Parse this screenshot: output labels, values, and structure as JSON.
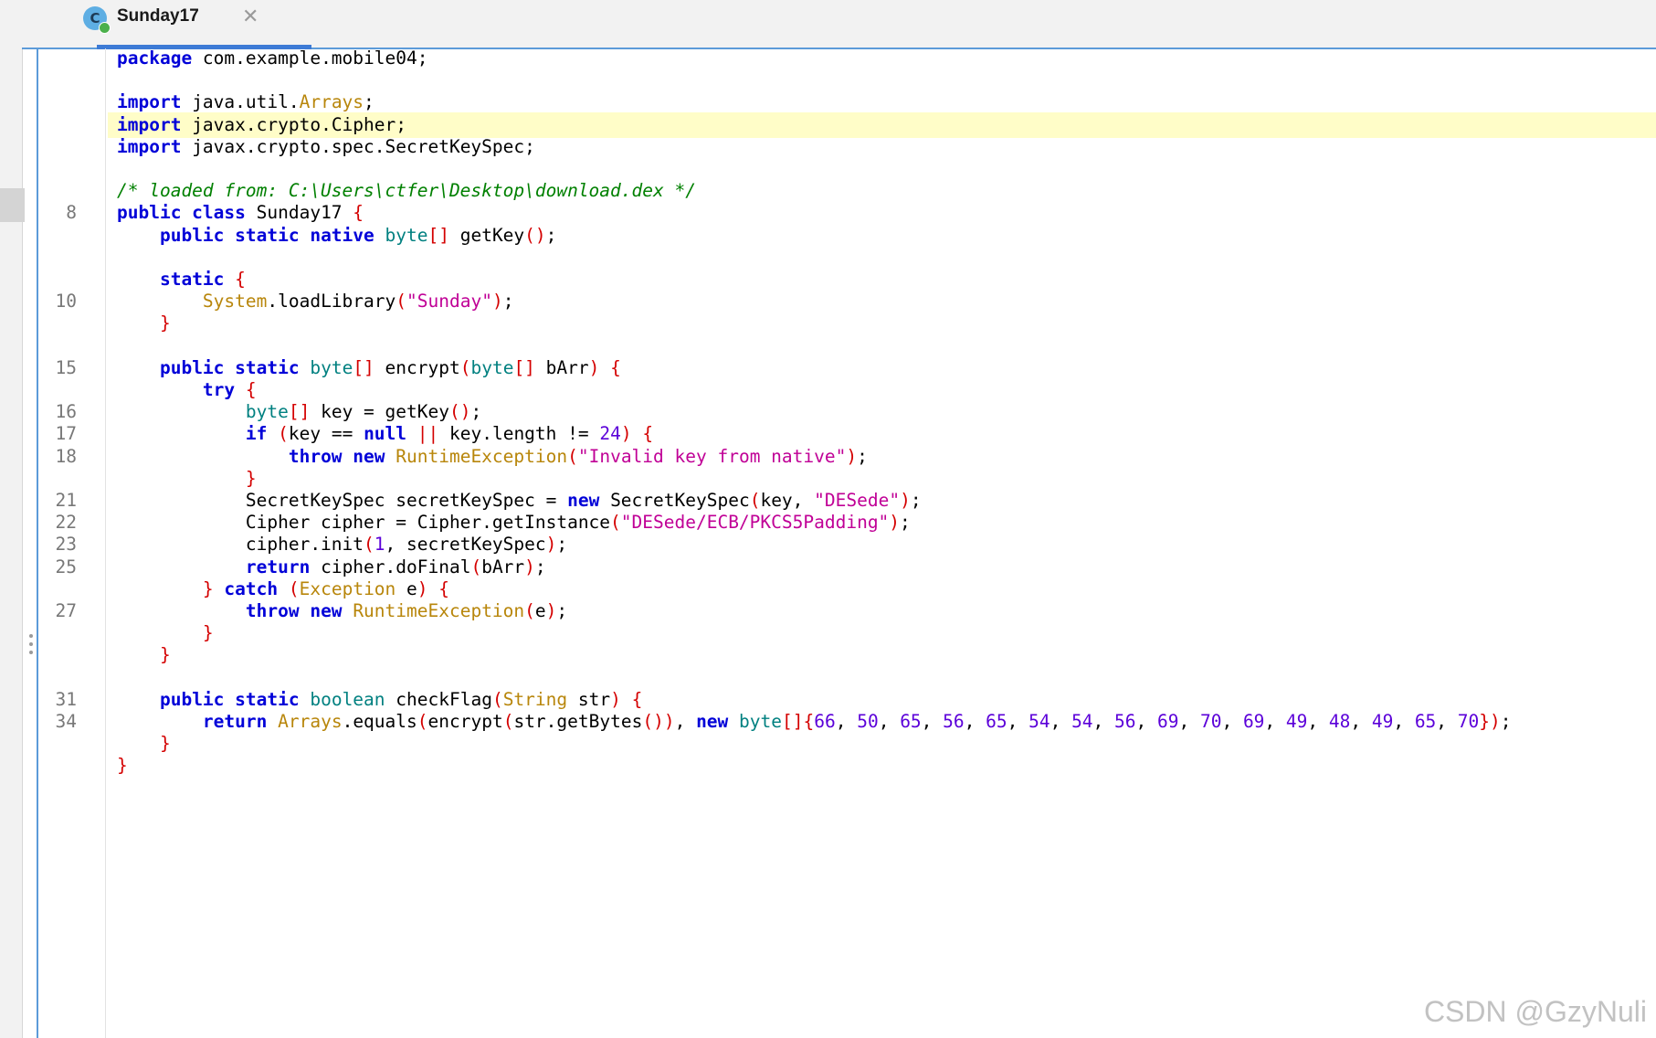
{
  "tab": {
    "title": "Sunday17",
    "icon_letter": "C",
    "close_glyph": "✕"
  },
  "code_lines": [
    {
      "num": "",
      "tokens": [
        [
          "kw",
          "package"
        ],
        [
          "p",
          " com.example.mobile04;"
        ]
      ]
    },
    {
      "num": "",
      "tokens": []
    },
    {
      "num": "",
      "tokens": [
        [
          "kw",
          "import"
        ],
        [
          "p",
          " java.util."
        ],
        [
          "cl",
          "Arrays"
        ],
        [
          "p",
          ";"
        ]
      ]
    },
    {
      "num": "",
      "highlight": true,
      "tokens": [
        [
          "kw",
          "import"
        ],
        [
          "p",
          " javax.crypto.Cipher;"
        ]
      ]
    },
    {
      "num": "",
      "tokens": [
        [
          "kw",
          "import"
        ],
        [
          "p",
          " javax.crypto.spec.SecretKeySpec;"
        ]
      ]
    },
    {
      "num": "",
      "tokens": []
    },
    {
      "num": "",
      "tokens": [
        [
          "cm",
          "/* loaded from: C:\\Users\\ctfer\\Desktop\\download.dex */"
        ]
      ]
    },
    {
      "num": "8",
      "tokens": [
        [
          "kw",
          "public class"
        ],
        [
          "p",
          " Sunday17 "
        ],
        [
          "br",
          "{"
        ]
      ]
    },
    {
      "num": "",
      "tokens": [
        [
          "p",
          "    "
        ],
        [
          "kw",
          "public static native"
        ],
        [
          "p",
          " "
        ],
        [
          "ty",
          "byte"
        ],
        [
          "br",
          "[]"
        ],
        [
          "p",
          " getKey"
        ],
        [
          "br",
          "()"
        ],
        [
          "p",
          ";"
        ]
      ]
    },
    {
      "num": "",
      "tokens": []
    },
    {
      "num": "",
      "tokens": [
        [
          "p",
          "    "
        ],
        [
          "kw",
          "static"
        ],
        [
          "p",
          " "
        ],
        [
          "br",
          "{"
        ]
      ]
    },
    {
      "num": "10",
      "tokens": [
        [
          "p",
          "        "
        ],
        [
          "cl",
          "System"
        ],
        [
          "p",
          ".loadLibrary"
        ],
        [
          "br",
          "("
        ],
        [
          "st",
          "\"Sunday\""
        ],
        [
          "br",
          ")"
        ],
        [
          "p",
          ";"
        ]
      ]
    },
    {
      "num": "",
      "tokens": [
        [
          "p",
          "    "
        ],
        [
          "br",
          "}"
        ]
      ]
    },
    {
      "num": "",
      "tokens": []
    },
    {
      "num": "15",
      "tokens": [
        [
          "p",
          "    "
        ],
        [
          "kw",
          "public static"
        ],
        [
          "p",
          " "
        ],
        [
          "ty",
          "byte"
        ],
        [
          "br",
          "[]"
        ],
        [
          "p",
          " encrypt"
        ],
        [
          "br",
          "("
        ],
        [
          "ty",
          "byte"
        ],
        [
          "br",
          "[]"
        ],
        [
          "p",
          " bArr"
        ],
        [
          "br",
          ")"
        ],
        [
          "p",
          " "
        ],
        [
          "br",
          "{"
        ]
      ]
    },
    {
      "num": "",
      "tokens": [
        [
          "p",
          "        "
        ],
        [
          "kw",
          "try"
        ],
        [
          "p",
          " "
        ],
        [
          "br",
          "{"
        ]
      ]
    },
    {
      "num": "16",
      "tokens": [
        [
          "p",
          "            "
        ],
        [
          "ty",
          "byte"
        ],
        [
          "br",
          "[]"
        ],
        [
          "p",
          " key = getKey"
        ],
        [
          "br",
          "()"
        ],
        [
          "p",
          ";"
        ]
      ]
    },
    {
      "num": "17",
      "tokens": [
        [
          "p",
          "            "
        ],
        [
          "kw",
          "if"
        ],
        [
          "p",
          " "
        ],
        [
          "br",
          "("
        ],
        [
          "p",
          "key == "
        ],
        [
          "kw",
          "null"
        ],
        [
          "p",
          " "
        ],
        [
          "br",
          "||"
        ],
        [
          "p",
          " key.length != "
        ],
        [
          "nu",
          "24"
        ],
        [
          "br",
          ")"
        ],
        [
          "p",
          " "
        ],
        [
          "br",
          "{"
        ]
      ]
    },
    {
      "num": "18",
      "tokens": [
        [
          "p",
          "                "
        ],
        [
          "kw",
          "throw new"
        ],
        [
          "p",
          " "
        ],
        [
          "cl",
          "RuntimeException"
        ],
        [
          "br",
          "("
        ],
        [
          "st",
          "\"Invalid key from native\""
        ],
        [
          "br",
          ")"
        ],
        [
          "p",
          ";"
        ]
      ]
    },
    {
      "num": "",
      "tokens": [
        [
          "p",
          "            "
        ],
        [
          "br",
          "}"
        ]
      ]
    },
    {
      "num": "21",
      "tokens": [
        [
          "p",
          "            SecretKeySpec secretKeySpec = "
        ],
        [
          "kw",
          "new"
        ],
        [
          "p",
          " SecretKeySpec"
        ],
        [
          "br",
          "("
        ],
        [
          "p",
          "key, "
        ],
        [
          "st",
          "\"DESede\""
        ],
        [
          "br",
          ")"
        ],
        [
          "p",
          ";"
        ]
      ]
    },
    {
      "num": "22",
      "tokens": [
        [
          "p",
          "            Cipher cipher = Cipher.getInstance"
        ],
        [
          "br",
          "("
        ],
        [
          "st",
          "\"DESede/ECB/PKCS5Padding\""
        ],
        [
          "br",
          ")"
        ],
        [
          "p",
          ";"
        ]
      ]
    },
    {
      "num": "23",
      "tokens": [
        [
          "p",
          "            cipher.init"
        ],
        [
          "br",
          "("
        ],
        [
          "nu",
          "1"
        ],
        [
          "p",
          ", secretKeySpec"
        ],
        [
          "br",
          ")"
        ],
        [
          "p",
          ";"
        ]
      ]
    },
    {
      "num": "25",
      "tokens": [
        [
          "p",
          "            "
        ],
        [
          "kw",
          "return"
        ],
        [
          "p",
          " cipher.doFinal"
        ],
        [
          "br",
          "("
        ],
        [
          "p",
          "bArr"
        ],
        [
          "br",
          ")"
        ],
        [
          "p",
          ";"
        ]
      ]
    },
    {
      "num": "",
      "tokens": [
        [
          "p",
          "        "
        ],
        [
          "br",
          "}"
        ],
        [
          "p",
          " "
        ],
        [
          "kw",
          "catch"
        ],
        [
          "p",
          " "
        ],
        [
          "br",
          "("
        ],
        [
          "cl",
          "Exception"
        ],
        [
          "p",
          " e"
        ],
        [
          "br",
          ")"
        ],
        [
          "p",
          " "
        ],
        [
          "br",
          "{"
        ]
      ]
    },
    {
      "num": "27",
      "tokens": [
        [
          "p",
          "            "
        ],
        [
          "kw",
          "throw new"
        ],
        [
          "p",
          " "
        ],
        [
          "cl",
          "RuntimeException"
        ],
        [
          "br",
          "("
        ],
        [
          "p",
          "e"
        ],
        [
          "br",
          ")"
        ],
        [
          "p",
          ";"
        ]
      ]
    },
    {
      "num": "",
      "tokens": [
        [
          "p",
          "        "
        ],
        [
          "br",
          "}"
        ]
      ]
    },
    {
      "num": "",
      "tokens": [
        [
          "p",
          "    "
        ],
        [
          "br",
          "}"
        ]
      ]
    },
    {
      "num": "",
      "tokens": []
    },
    {
      "num": "31",
      "tokens": [
        [
          "p",
          "    "
        ],
        [
          "kw",
          "public static"
        ],
        [
          "p",
          " "
        ],
        [
          "ty",
          "boolean"
        ],
        [
          "p",
          " checkFlag"
        ],
        [
          "br",
          "("
        ],
        [
          "cl",
          "String"
        ],
        [
          "p",
          " str"
        ],
        [
          "br",
          ")"
        ],
        [
          "p",
          " "
        ],
        [
          "br",
          "{"
        ]
      ]
    },
    {
      "num": "34",
      "tokens": [
        [
          "p",
          "        "
        ],
        [
          "kw",
          "return"
        ],
        [
          "p",
          " "
        ],
        [
          "cl",
          "Arrays"
        ],
        [
          "p",
          ".equals"
        ],
        [
          "br",
          "("
        ],
        [
          "p",
          "encrypt"
        ],
        [
          "br",
          "("
        ],
        [
          "p",
          "str.getBytes"
        ],
        [
          "br",
          "())"
        ],
        [
          "p",
          ", "
        ],
        [
          "kw",
          "new"
        ],
        [
          "p",
          " "
        ],
        [
          "ty",
          "byte"
        ],
        [
          "br",
          "[]{"
        ],
        [
          "nu",
          "66"
        ],
        [
          "p",
          ", "
        ],
        [
          "nu",
          "50"
        ],
        [
          "p",
          ", "
        ],
        [
          "nu",
          "65"
        ],
        [
          "p",
          ", "
        ],
        [
          "nu",
          "56"
        ],
        [
          "p",
          ", "
        ],
        [
          "nu",
          "65"
        ],
        [
          "p",
          ", "
        ],
        [
          "nu",
          "54"
        ],
        [
          "p",
          ", "
        ],
        [
          "nu",
          "54"
        ],
        [
          "p",
          ", "
        ],
        [
          "nu",
          "56"
        ],
        [
          "p",
          ", "
        ],
        [
          "nu",
          "69"
        ],
        [
          "p",
          ", "
        ],
        [
          "nu",
          "70"
        ],
        [
          "p",
          ", "
        ],
        [
          "nu",
          "69"
        ],
        [
          "p",
          ", "
        ],
        [
          "nu",
          "49"
        ],
        [
          "p",
          ", "
        ],
        [
          "nu",
          "48"
        ],
        [
          "p",
          ", "
        ],
        [
          "nu",
          "49"
        ],
        [
          "p",
          ", "
        ],
        [
          "nu",
          "65"
        ],
        [
          "p",
          ", "
        ],
        [
          "nu",
          "70"
        ],
        [
          "br",
          "})"
        ],
        [
          "p",
          ";"
        ]
      ]
    },
    {
      "num": "",
      "tokens": [
        [
          "p",
          "    "
        ],
        [
          "br",
          "}"
        ]
      ]
    },
    {
      "num": "",
      "tokens": [
        [
          "br",
          "}"
        ]
      ]
    }
  ],
  "watermark": "CSDN @GzyNuli"
}
